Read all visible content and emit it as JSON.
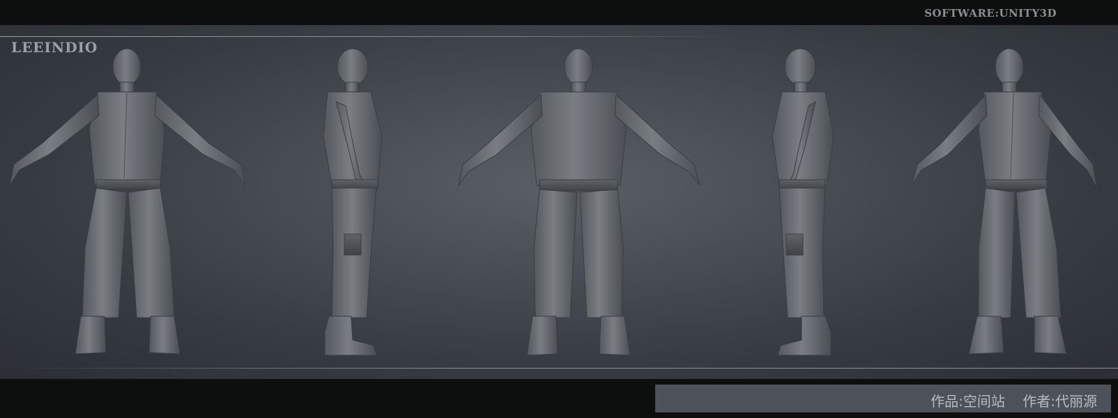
{
  "header": {
    "software": "SOFTWARE:UNITY3D"
  },
  "stage": {
    "brand": "LEEINDIO",
    "views": [
      {
        "name": "front"
      },
      {
        "name": "side-right"
      },
      {
        "name": "back"
      },
      {
        "name": "side-left"
      },
      {
        "name": "three-quarter"
      }
    ]
  },
  "footer": {
    "credit": "作品:空间站    作者:代丽源"
  },
  "colors": {
    "background": "#0c0f0e",
    "stage_center": "#5a5f66",
    "stage_edge": "#2b2f35",
    "model": "#6e7276",
    "credit_box": "#4d5159",
    "label": "#8a8f93"
  }
}
